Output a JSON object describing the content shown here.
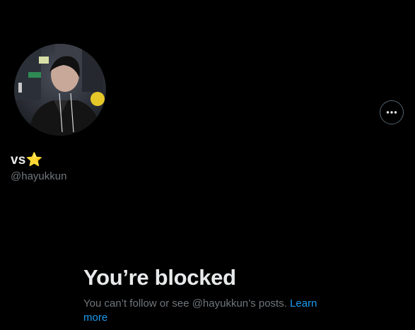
{
  "profile": {
    "display_name": "vs⭐",
    "handle": "@hayukkun",
    "avatar_icon": "profile-photo",
    "more_icon": "more-horizontal-icon"
  },
  "blocked": {
    "title": "You’re blocked",
    "description": "You can’t follow or see @hayukkun’s posts.",
    "learn_more": "Learn more"
  },
  "colors": {
    "background": "#000000",
    "primary_text": "#e7e9ea",
    "secondary_text": "#71767b",
    "link": "#1d9bf0"
  }
}
